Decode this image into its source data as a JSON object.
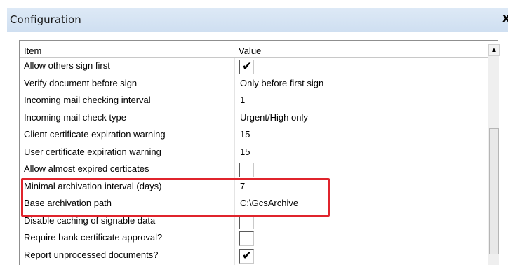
{
  "window": {
    "title": "Configuration",
    "close_glyph": "x",
    "close_icon": "close-icon"
  },
  "table": {
    "columns": {
      "item": "Item",
      "value": "Value"
    },
    "rows": [
      {
        "name": "Allow others sign first",
        "type": "checkbox",
        "checked": true
      },
      {
        "name": "Verify document before sign",
        "type": "text",
        "value": "Only before first sign"
      },
      {
        "name": "Incoming mail checking interval",
        "type": "text",
        "value": "1"
      },
      {
        "name": "Incoming mail check type",
        "type": "text",
        "value": "Urgent/High only"
      },
      {
        "name": "Client certificate expiration warning",
        "type": "text",
        "value": "15"
      },
      {
        "name": "User certificate expiration warning",
        "type": "text",
        "value": "15"
      },
      {
        "name": "Allow almost expired certicates",
        "type": "checkbox",
        "checked": false
      },
      {
        "name": "Minimal archivation interval (days)",
        "type": "text",
        "value": "7"
      },
      {
        "name": "Base archivation path",
        "type": "text",
        "value": "C:\\GcsArchive"
      },
      {
        "name": "Disable caching of signable data",
        "type": "checkbox",
        "checked": false
      },
      {
        "name": "Require bank certificate approval?",
        "type": "checkbox",
        "checked": false
      },
      {
        "name": "Report unprocessed documents?",
        "type": "checkbox",
        "checked": true
      }
    ]
  },
  "scrollbar": {
    "up_arrow": "▲"
  },
  "colors": {
    "highlight": "#e0242c",
    "titlebar": "#d6e4f4"
  },
  "check_glyph": "✔"
}
